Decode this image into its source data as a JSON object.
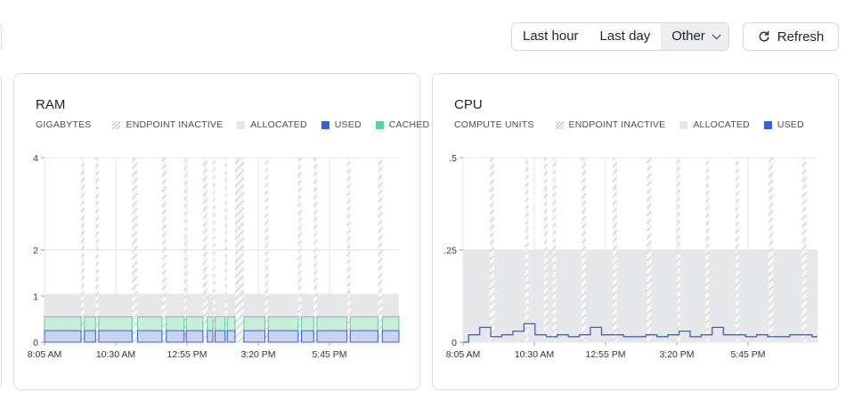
{
  "toolbar": {
    "ranges": [
      {
        "label": "Last hour",
        "active": false
      },
      {
        "label": "Last day",
        "active": false
      },
      {
        "label": "Other",
        "active": true
      }
    ],
    "refresh_label": "Refresh"
  },
  "colors": {
    "used": "#3b5fd9",
    "cached": "#5ad29a",
    "allocated": "#e6e7e9",
    "inactive": "#c9cbcf",
    "grid": "#e3e4e6"
  },
  "icons": {
    "dropdown": "chevron-down-icon",
    "refresh": "refresh-icon",
    "inactive_swatch": "hatched-swatch"
  },
  "charts": {
    "ram": {
      "title": "RAM",
      "unit_label": "GIGABYTES",
      "legend": [
        "ENDPOINT INACTIVE",
        "ALLOCATED",
        "USED",
        "CACHED"
      ]
    },
    "cpu": {
      "title": "CPU",
      "unit_label": "COMPUTE UNITS",
      "legend": [
        "ENDPOINT INACTIVE",
        "ALLOCATED",
        "USED"
      ]
    }
  },
  "chart_data": [
    {
      "type": "area",
      "title": "RAM",
      "ylabel": "GIGABYTES",
      "ylim": [
        0,
        4
      ],
      "yticks": [
        0,
        1,
        2,
        4
      ],
      "ytick_labels": [
        "0",
        "1",
        "2",
        "4"
      ],
      "xlim": [
        "08:05",
        "13:25"
      ],
      "xticks": [
        "8:05 AM",
        "10:30 AM",
        "12:55 PM",
        "3:20 PM",
        "5:45 PM"
      ],
      "grid": true,
      "legend_position": "top-left",
      "series": [
        {
          "name": "ALLOCATED",
          "constant": 1.05
        },
        {
          "name": "CACHED",
          "approx_value": 0.55
        },
        {
          "name": "USED",
          "approx_value": 0.25
        }
      ],
      "active_segments": [
        {
          "start": "08:05",
          "end": "08:38"
        },
        {
          "start": "08:41",
          "end": "08:51"
        },
        {
          "start": "08:54",
          "end": "09:24"
        },
        {
          "start": "09:29",
          "end": "09:51"
        },
        {
          "start": "09:55",
          "end": "10:11"
        },
        {
          "start": "10:13",
          "end": "10:28"
        },
        {
          "start": "10:32",
          "end": "10:37"
        },
        {
          "start": "10:39",
          "end": "10:48"
        },
        {
          "start": "10:50",
          "end": "10:57"
        },
        {
          "start": "11:05",
          "end": "11:24"
        },
        {
          "start": "11:27",
          "end": "11:54"
        },
        {
          "start": "11:57",
          "end": "12:08"
        },
        {
          "start": "12:11",
          "end": "12:38"
        },
        {
          "start": "12:41",
          "end": "13:06"
        },
        {
          "start": "13:10",
          "end": "13:34"
        },
        {
          "start": "13:37",
          "end": "14:01"
        },
        {
          "start": "14:05",
          "end": "14:34"
        },
        {
          "start": "14:38",
          "end": "15:03"
        },
        {
          "start": "15:07",
          "end": "15:16"
        },
        {
          "start": "15:21",
          "end": "15:47"
        },
        {
          "start": "15:51",
          "end": "16:21"
        },
        {
          "start": "16:24",
          "end": "16:42"
        },
        {
          "start": "16:45",
          "end": "17:02"
        },
        {
          "start": "17:05",
          "end": "17:19"
        },
        {
          "start": "17:22",
          "end": "17:46"
        },
        {
          "start": "17:48",
          "end": "18:12"
        },
        {
          "start": "18:16",
          "end": "18:34"
        },
        {
          "start": "18:37",
          "end": "19:13"
        },
        {
          "start": "19:16",
          "end": "19:31"
        },
        {
          "start": "19:35",
          "end": "19:49"
        }
      ]
    },
    {
      "type": "line",
      "title": "CPU",
      "ylabel": "COMPUTE UNITS",
      "ylim": [
        0,
        0.5
      ],
      "yticks": [
        0,
        0.25,
        0.5
      ],
      "ytick_labels": [
        "0",
        ".25",
        ".5"
      ],
      "xlim": [
        "08:05",
        "13:25"
      ],
      "xticks": [
        "8:05 AM",
        "10:30 AM",
        "12:55 PM",
        "3:20 PM",
        "5:45 PM"
      ],
      "grid": true,
      "legend_position": "top-left",
      "series": [
        {
          "name": "ALLOCATED",
          "constant": 0.25
        },
        {
          "name": "USED",
          "x": [
            "08:10",
            "08:20",
            "08:30",
            "08:40",
            "08:50",
            "09:00",
            "09:10",
            "09:20",
            "09:30",
            "09:40",
            "09:50",
            "10:00",
            "10:10",
            "10:20",
            "10:30",
            "10:40",
            "10:50",
            "11:00",
            "11:10",
            "11:20",
            "11:30",
            "11:40",
            "11:50",
            "12:00",
            "12:10",
            "12:20",
            "12:30",
            "12:40",
            "12:50",
            "13:00",
            "13:10",
            "13:20",
            "13:30",
            "13:40",
            "13:50",
            "14:00",
            "14:10",
            "14:20",
            "14:30",
            "14:40",
            "14:50",
            "15:00",
            "15:10",
            "15:20",
            "15:30",
            "15:40",
            "15:50",
            "16:00",
            "16:10",
            "16:20",
            "16:30",
            "16:40",
            "16:50",
            "17:00",
            "17:10",
            "17:20",
            "17:30",
            "17:40",
            "17:50",
            "18:00",
            "18:10",
            "18:20",
            "18:30",
            "18:40",
            "18:50",
            "19:00",
            "19:10",
            "19:20",
            "19:30",
            "19:40",
            "19:50"
          ],
          "values": [
            0.02,
            0.04,
            0.015,
            0.02,
            0.03,
            0.05,
            0.02,
            0.015,
            0.02,
            0.015,
            0.02,
            0.04,
            0.02,
            0.02,
            0.015,
            0.015,
            0.02,
            0.015,
            0.02,
            0.03,
            0.015,
            0.02,
            0.04,
            0.02,
            0.02,
            0.015,
            0.02,
            0.015,
            0.015,
            0.02,
            0.02,
            0.015,
            0.015,
            0.02,
            0.015,
            0.02,
            0.015,
            0.02,
            0.015,
            0.02,
            0.02,
            0.015,
            0.02,
            0.02,
            0.015,
            0.015,
            0.02,
            0.015,
            0.015,
            0.02,
            0.015,
            0.02,
            0.015,
            0.02,
            0.015,
            0.02,
            0.02,
            0.015,
            0.015,
            0.02,
            0.015,
            0.02,
            0.04,
            0.015,
            0.02,
            0.015,
            0.015,
            0.02,
            0.02,
            0.02,
            0.02
          ]
        }
      ],
      "active_segments": [
        {
          "start": "08:05",
          "end": "08:29"
        },
        {
          "start": "08:33",
          "end": "09:01"
        },
        {
          "start": "09:04",
          "end": "09:18"
        },
        {
          "start": "09:21",
          "end": "09:26"
        },
        {
          "start": "09:29",
          "end": "09:52"
        },
        {
          "start": "09:56",
          "end": "10:20"
        },
        {
          "start": "10:24",
          "end": "10:51"
        },
        {
          "start": "10:55",
          "end": "11:18"
        },
        {
          "start": "11:21",
          "end": "11:44"
        },
        {
          "start": "11:47",
          "end": "12:11"
        },
        {
          "start": "12:14",
          "end": "12:41"
        },
        {
          "start": "12:45",
          "end": "13:11"
        },
        {
          "start": "13:15",
          "end": "13:42"
        },
        {
          "start": "13:45",
          "end": "14:11"
        },
        {
          "start": "14:15",
          "end": "14:41"
        },
        {
          "start": "14:45",
          "end": "15:12"
        },
        {
          "start": "15:16",
          "end": "15:45"
        },
        {
          "start": "15:49",
          "end": "16:18"
        },
        {
          "start": "16:22",
          "end": "16:49"
        },
        {
          "start": "16:53",
          "end": "17:21"
        },
        {
          "start": "17:25",
          "end": "17:52"
        },
        {
          "start": "17:56",
          "end": "18:24"
        },
        {
          "start": "18:28",
          "end": "18:58"
        },
        {
          "start": "19:02",
          "end": "19:30"
        },
        {
          "start": "19:34",
          "end": "19:50"
        }
      ]
    }
  ]
}
